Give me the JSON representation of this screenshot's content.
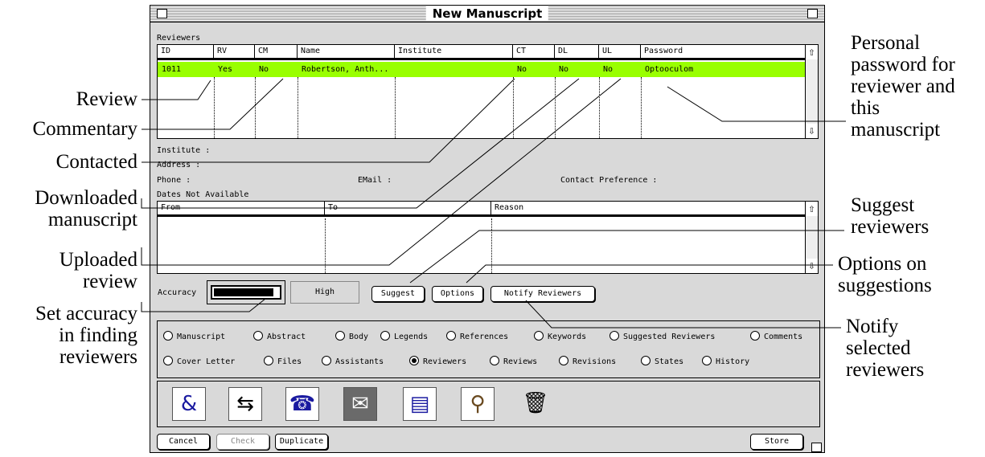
{
  "window": {
    "title": "New Manuscript"
  },
  "reviewers_section": {
    "label": "Reviewers"
  },
  "reviewers_table": {
    "columns": [
      "ID",
      "RV",
      "CM",
      "Name",
      "Institute",
      "CT",
      "DL",
      "UL",
      "Password"
    ],
    "rows": [
      {
        "id": "1011",
        "rv": "Yes",
        "cm": "No",
        "name": "Robertson, Anth...",
        "institute": "",
        "ct": "No",
        "dl": "No",
        "ul": "No",
        "password": "Optooculom"
      }
    ]
  },
  "details": {
    "institute_label": "Institute :",
    "address_label": "Address :",
    "phone_label": "Phone :",
    "email_label": "EMail :",
    "contact_label": "Contact Preference :",
    "dates_label": "Dates Not Available"
  },
  "dates_table": {
    "columns": [
      "From",
      "To",
      "Reason"
    ]
  },
  "accuracy": {
    "label": "Accuracy",
    "value_text": "High",
    "level_fraction": 0.95
  },
  "buttons": {
    "suggest": "Suggest",
    "options": "Options",
    "notify": "Notify Reviewers",
    "cancel": "Cancel",
    "check": "Check",
    "duplicate": "Duplicate",
    "store": "Store"
  },
  "tabs_row1": [
    "Manuscript",
    "Abstract",
    "Body",
    "Legends",
    "References",
    "Keywords",
    "Suggested Reviewers",
    "Comments"
  ],
  "tabs_row2": [
    "Cover Letter",
    "Files",
    "Assistants",
    "Reviewers",
    "Reviews",
    "Revisions",
    "States",
    "History"
  ],
  "selected_tab": "Reviewers",
  "toolbar_icons": [
    "print-letter-icon",
    "transfer-icon",
    "fax-icon",
    "mail-icon",
    "document-icon",
    "magnifier-icon",
    "trash-icon"
  ],
  "colors": {
    "row_highlight": "#99ff00"
  },
  "annotations": {
    "review": "Review",
    "commentary": "Commentary",
    "contacted": "Contacted",
    "downloaded_1": "Downloaded",
    "downloaded_2": "manuscript",
    "uploaded_1": "Uploaded",
    "uploaded_2": "review",
    "accuracy_1": "Set accuracy",
    "accuracy_2": "in finding",
    "accuracy_3": "reviewers",
    "password_1": "Personal",
    "password_2": "password for",
    "password_3": "reviewer and",
    "password_4": "this",
    "password_5": "manuscript",
    "suggest_1": "Suggest",
    "suggest_2": "reviewers",
    "options_1": "Options on",
    "options_2": "suggestions",
    "notify_1": "Notify",
    "notify_2": "selected",
    "notify_3": "reviewers"
  }
}
